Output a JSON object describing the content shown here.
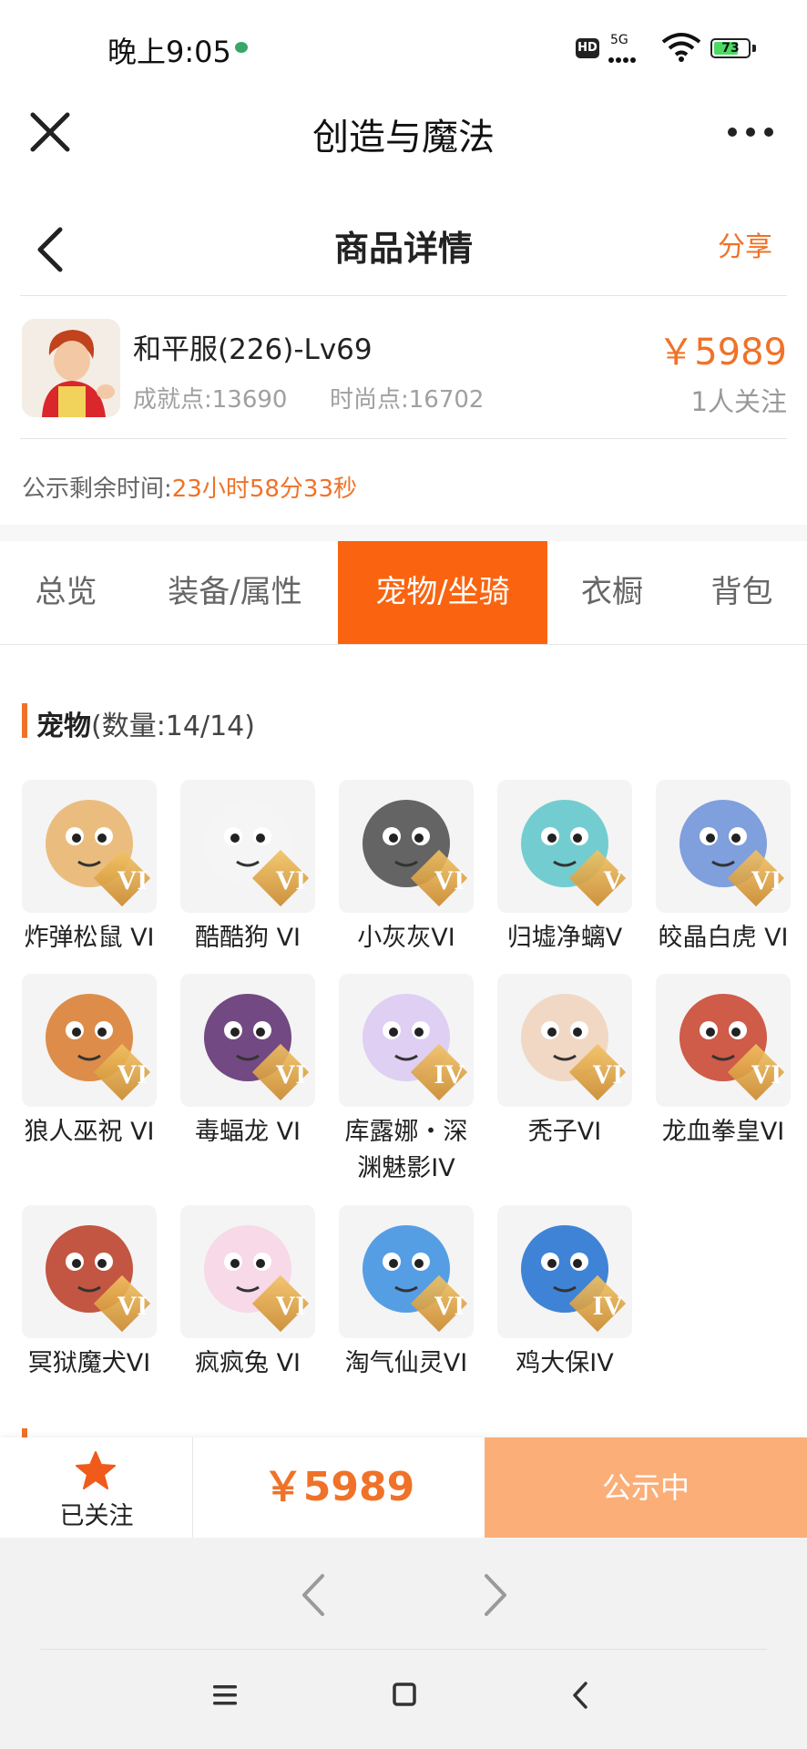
{
  "status_bar": {
    "time": "晚上9:05",
    "hd": "HD",
    "network": "5G",
    "battery": "73",
    "battery_level": 0.73
  },
  "app": {
    "title": "创造与魔法"
  },
  "page": {
    "title": "商品详情",
    "share": "分享"
  },
  "product": {
    "name": "和平服(226)-Lv69",
    "achievement": "成就点:13690",
    "fashion": "时尚点:16702",
    "price": "￥5989",
    "followers": "1人关注"
  },
  "countdown": {
    "label": "公示剩余时间:",
    "value": "23小时58分33秒"
  },
  "tabs": [
    {
      "label": "总览",
      "active": false
    },
    {
      "label": "装备/属性",
      "active": false
    },
    {
      "label": "宠物/坐骑",
      "active": true
    },
    {
      "label": "衣橱",
      "active": false
    },
    {
      "label": "背包",
      "active": false
    }
  ],
  "pets_section": {
    "title": "宠物",
    "count": "(数量:14/14)",
    "items": [
      {
        "name": "炸弹松鼠 VI",
        "grade": "VI",
        "icon": "squirrel-pet-icon",
        "color": "#e8b36a"
      },
      {
        "name": "酷酷狗 VI",
        "grade": "VI",
        "icon": "dog-pet-icon",
        "color": "#f4f4f4"
      },
      {
        "name": "小灰灰VI",
        "grade": "VI",
        "icon": "grey-wolf-pet-icon",
        "color": "#4a4a4a"
      },
      {
        "name": "归墟净螭V",
        "grade": "V",
        "icon": "dragon-pet-icon",
        "color": "#5cc6c9"
      },
      {
        "name": "皎晶白虎 VI",
        "grade": "VI",
        "icon": "white-tiger-pet-icon",
        "color": "#6a8fd8"
      },
      {
        "name": "狼人巫祝 VI",
        "grade": "VI",
        "icon": "werewolf-pet-icon",
        "color": "#d87a2a"
      },
      {
        "name": "毒蝠龙 VI",
        "grade": "VI",
        "icon": "bat-dragon-pet-icon",
        "color": "#5a2a6e"
      },
      {
        "name": "库露娜・深渊魅影IV",
        "grade": "IV",
        "icon": "kuluna-pet-icon",
        "color": "#d9c8f2"
      },
      {
        "name": "秃子VI",
        "grade": "VI",
        "icon": "bald-pet-icon",
        "color": "#f0d2bc"
      },
      {
        "name": "龙血拳皇VI",
        "grade": "VI",
        "icon": "dragon-fist-pet-icon",
        "color": "#c8402a"
      },
      {
        "name": "冥狱魔犬VI",
        "grade": "VI",
        "icon": "hellhound-pet-icon",
        "color": "#b83a22"
      },
      {
        "name": "疯疯兔 VI",
        "grade": "VI",
        "icon": "rabbit-pet-icon",
        "color": "#f7d4e4"
      },
      {
        "name": "淘气仙灵VI",
        "grade": "VI",
        "icon": "fairy-pet-icon",
        "color": "#3a8ee0"
      },
      {
        "name": "鸡大保IV",
        "grade": "IV",
        "icon": "chicken-pet-icon",
        "color": "#1f6fd0"
      }
    ]
  },
  "action_bar": {
    "follow_label": "已关注",
    "price": "￥5989",
    "status_button": "公示中"
  }
}
